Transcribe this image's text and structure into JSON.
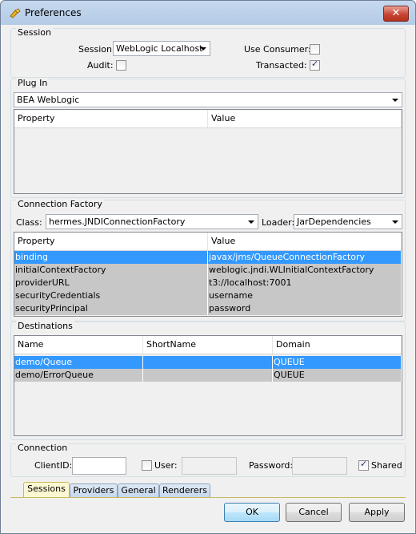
{
  "window": {
    "title": "Preferences",
    "close_glyph": "✕"
  },
  "session": {
    "group_title": "Session",
    "session_label": "Session:",
    "session_value": "WebLogic Localhost",
    "use_consumer_label": "Use Consumer:",
    "use_consumer_checked": false,
    "audit_label": "Audit:",
    "audit_checked": false,
    "transacted_label": "Transacted:",
    "transacted_checked": true
  },
  "plugin": {
    "group_title": "Plug In",
    "selected": "BEA WebLogic",
    "columns": [
      "Property",
      "Value"
    ],
    "rows": []
  },
  "connection_factory": {
    "group_title": "Connection Factory",
    "class_label": "Class:",
    "class_value": "hermes.JNDIConnectionFactory",
    "loader_label": "Loader:",
    "loader_value": "JarDependencies",
    "columns": [
      "Property",
      "Value"
    ],
    "rows": [
      {
        "property": "binding",
        "value": "javax/jms/QueueConnectionFactory",
        "state": "selected"
      },
      {
        "property": "initialContextFactory",
        "value": "weblogic.jndi.WLInitialContextFactory",
        "state": "normal"
      },
      {
        "property": "providerURL",
        "value": "t3://localhost:7001",
        "state": "normal"
      },
      {
        "property": "securityCredentials",
        "value": "username",
        "state": "normal"
      },
      {
        "property": "securityPrincipal",
        "value": "password",
        "state": "normal"
      }
    ]
  },
  "destinations": {
    "group_title": "Destinations",
    "columns": [
      "Name",
      "ShortName",
      "Domain"
    ],
    "rows": [
      {
        "name": "demo/Queue",
        "short_name": "",
        "domain": "QUEUE",
        "state": "selected"
      },
      {
        "name": "demo/ErrorQueue",
        "short_name": "",
        "domain": "QUEUE",
        "state": "normal"
      }
    ]
  },
  "connection": {
    "group_title": "Connection",
    "client_id_label": "ClientID:",
    "client_id_value": "",
    "user_label": "User:",
    "user_checked": false,
    "user_value": "",
    "password_label": "Password:",
    "password_value": "",
    "shared_label": "Shared",
    "shared_checked": true
  },
  "tabs": [
    {
      "label": "Sessions",
      "active": true
    },
    {
      "label": "Providers",
      "active": false
    },
    {
      "label": "General",
      "active": false
    },
    {
      "label": "Renderers",
      "active": false
    }
  ],
  "buttons": {
    "ok": "OK",
    "cancel": "Cancel",
    "apply": "Apply"
  },
  "colors": {
    "selection": "#3399ff",
    "row_gray": "#c7c7c7"
  }
}
